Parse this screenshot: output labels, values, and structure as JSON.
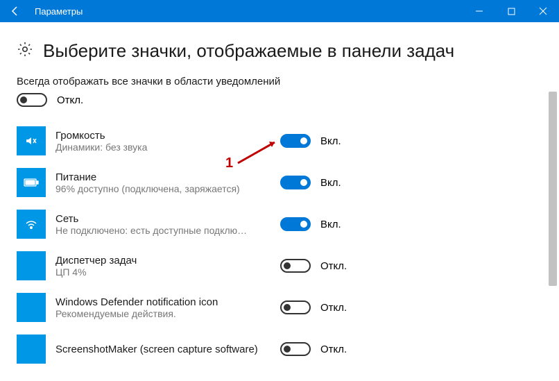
{
  "window": {
    "title": "Параметры"
  },
  "page": {
    "heading": "Выберите значки, отображаемые в панели задач",
    "always_show_label": "Всегда отображать все значки в области уведомлений",
    "master_toggle_state": "Откл."
  },
  "state_labels": {
    "on": "Вкл.",
    "off": "Откл."
  },
  "items": [
    {
      "icon": "volume-icon",
      "title": "Громкость",
      "desc": "Динамики: без звука",
      "on": true
    },
    {
      "icon": "battery-icon",
      "title": "Питание",
      "desc": "96% доступно (подключена, заряжается)",
      "on": true
    },
    {
      "icon": "wifi-icon",
      "title": "Сеть",
      "desc": "Не подключено: есть доступные подклю…",
      "on": true
    },
    {
      "icon": "blank-icon",
      "title": "Диспетчер задач",
      "desc": "ЦП 4%",
      "on": false
    },
    {
      "icon": "blank-icon",
      "title": "Windows Defender notification icon",
      "desc": "Рекомендуемые действия.",
      "on": false
    },
    {
      "icon": "blank-icon",
      "title": "ScreenshotMaker (screen capture software)",
      "desc": "",
      "on": false
    }
  ],
  "annotation": {
    "label": "1"
  }
}
